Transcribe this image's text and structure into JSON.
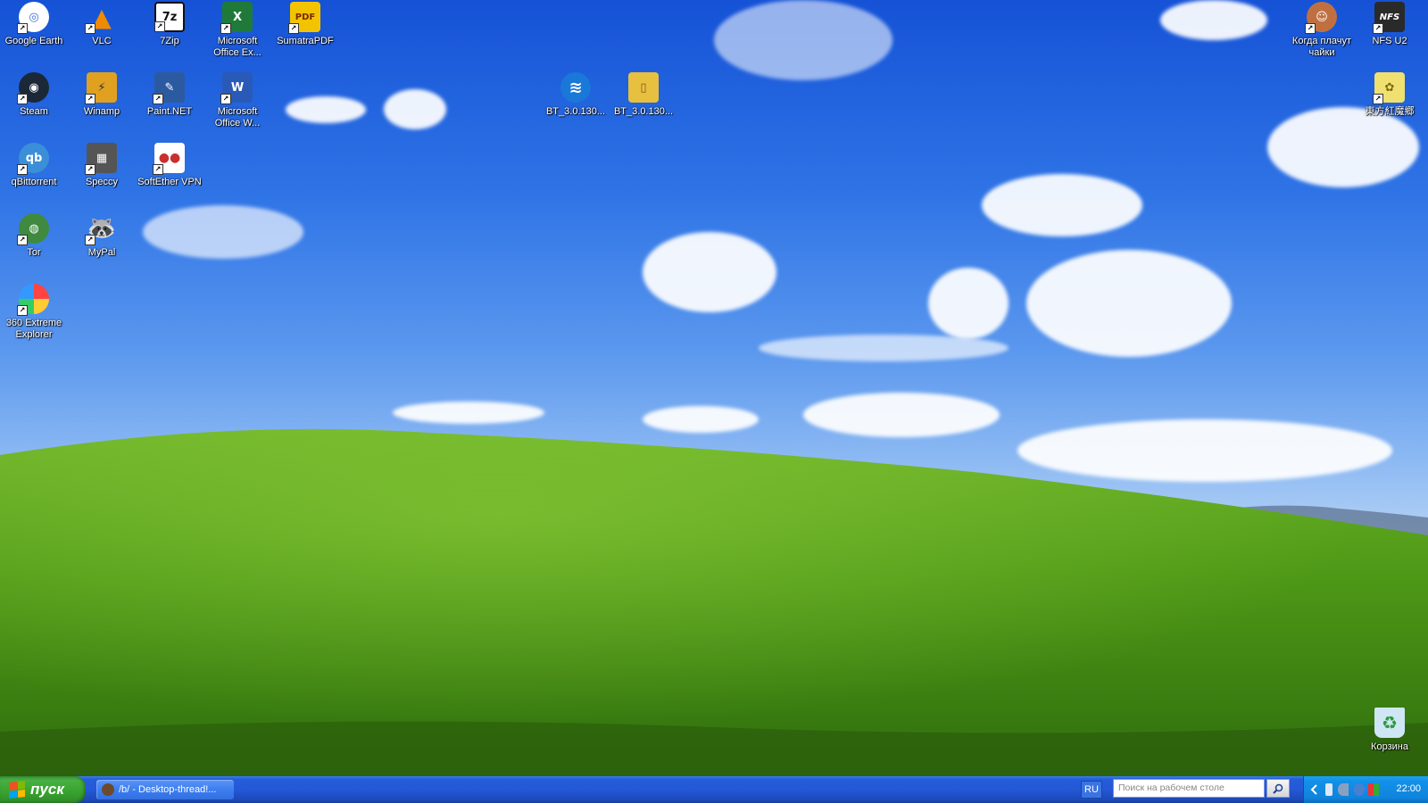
{
  "desktop": {
    "icons": [
      {
        "label": "Google Earth",
        "icon": "google-earth-icon",
        "color": "#ffffff",
        "glyph": "◎"
      },
      {
        "label": "VLC",
        "icon": "vlc-icon",
        "color": "#f08a00",
        "glyph": "▲"
      },
      {
        "label": "7Zip",
        "icon": "7zip-icon",
        "color": "#222222",
        "glyph": "7z"
      },
      {
        "label": "Microsoft Office Ex...",
        "icon": "excel-icon",
        "color": "#1f7a3a",
        "glyph": "X"
      },
      {
        "label": "SumatraPDF",
        "icon": "sumatrapdf-icon",
        "color": "#f2c400",
        "glyph": "PDF"
      },
      {
        "label": "Steam",
        "icon": "steam-icon",
        "color": "#1b2838",
        "glyph": "◉"
      },
      {
        "label": "Winamp",
        "icon": "winamp-icon",
        "color": "#e0a020",
        "glyph": "⚡"
      },
      {
        "label": "Paint.NET",
        "icon": "paintnet-icon",
        "color": "#2c5aa0",
        "glyph": "✎"
      },
      {
        "label": "Microsoft Office W...",
        "icon": "word-icon",
        "color": "#2a5ab7",
        "glyph": "W"
      },
      {
        "label": "qBittorrent",
        "icon": "qbittorrent-icon",
        "color": "#3a8fd8",
        "glyph": "qb"
      },
      {
        "label": "Speccy",
        "icon": "speccy-icon",
        "color": "#555555",
        "glyph": "▦"
      },
      {
        "label": "SoftEther VPN",
        "icon": "softether-icon",
        "color": "#c83030",
        "glyph": "●●"
      },
      {
        "label": "Tor",
        "icon": "tor-icon",
        "color": "#3f8a3f",
        "glyph": "◍"
      },
      {
        "label": "MyPal",
        "icon": "mypal-icon",
        "color": "#6b5030",
        "glyph": "🦝"
      },
      {
        "label": "360 Extreme Explorer",
        "icon": "360-browser-icon",
        "color": "#e85090",
        "glyph": "◐"
      },
      {
        "label": "BT_3.0.130...",
        "icon": "bluetooth-wifi-icon",
        "color": "#1a78d8",
        "glyph": "≋"
      },
      {
        "label": "BT_3.0.130...",
        "icon": "zip-folder-icon",
        "color": "#e8c040",
        "glyph": "▯"
      },
      {
        "label": "Когда плачут чайки",
        "icon": "anime-shortcut-icon",
        "color": "#c07040",
        "glyph": "☺"
      },
      {
        "label": "NFS U2",
        "icon": "nfs-u2-icon",
        "color": "#2a2a2a",
        "glyph": "NFS"
      },
      {
        "label": "東方紅魔郷",
        "icon": "touhou-icon",
        "color": "#f0e070",
        "glyph": "✿"
      },
      {
        "label": "Корзина",
        "icon": "recycle-bin-icon",
        "color": "#cfe6f5",
        "glyph": "♻"
      }
    ]
  },
  "taskbar": {
    "start_label": "пуск",
    "task_button_label": "/b/ - Desktop-thread!...",
    "language": "RU",
    "search_placeholder": "Поиск на рабочем столе",
    "clock": "22:00"
  }
}
